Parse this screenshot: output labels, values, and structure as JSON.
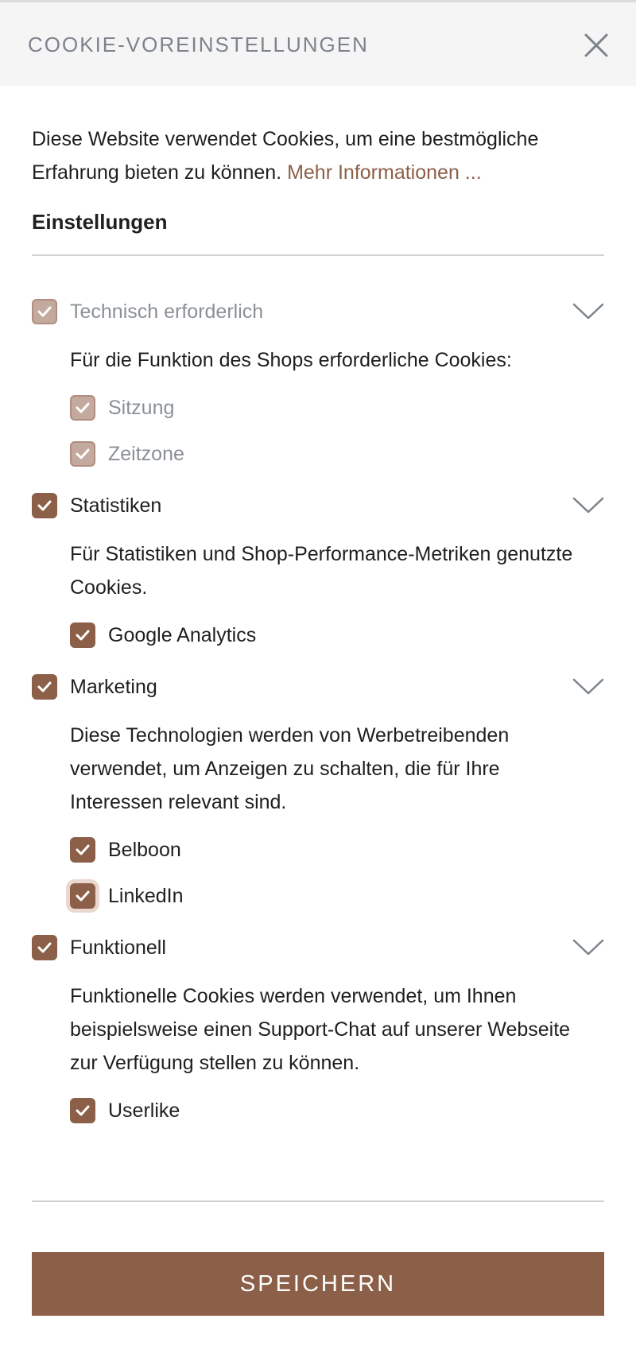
{
  "modal": {
    "title": "COOKIE-VOREINSTELLUNGEN",
    "close_icon": "close-icon"
  },
  "intro": {
    "text": "Diese Website verwendet Cookies, um eine bestmögliche Erfahrung bieten zu können.",
    "link_text": "Mehr Informationen ..."
  },
  "settings_heading": "Einstellungen",
  "categories": [
    {
      "label": "Technisch erforderlich",
      "checked": true,
      "disabled": true,
      "description": "Für die Funktion des Shops erforderliche Cookies:",
      "items": [
        {
          "label": "Sitzung",
          "checked": true,
          "disabled": true
        },
        {
          "label": "Zeitzone",
          "checked": true,
          "disabled": true
        }
      ]
    },
    {
      "label": "Statistiken",
      "checked": true,
      "disabled": false,
      "description": "Für Statistiken und Shop-Performance-Metriken genutzte Cookies.",
      "items": [
        {
          "label": "Google Analytics",
          "checked": true,
          "disabled": false
        }
      ]
    },
    {
      "label": "Marketing",
      "checked": true,
      "disabled": false,
      "description": "Diese Technologien werden von Werbetreibenden verwendet, um Anzeigen zu schalten, die für Ihre Interessen relevant sind.",
      "items": [
        {
          "label": "Belboon",
          "checked": true,
          "disabled": false
        },
        {
          "label": "LinkedIn",
          "checked": true,
          "disabled": false,
          "focused": true
        }
      ]
    },
    {
      "label": "Funktionell",
      "checked": true,
      "disabled": false,
      "description": "Funktionelle Cookies werden verwendet, um Ihnen beispielsweise einen Support-Chat auf unserer Webseite zur Verfügung stellen zu können.",
      "items": [
        {
          "label": "Userlike",
          "checked": true,
          "disabled": false
        }
      ]
    }
  ],
  "save_button": "SPEICHERN",
  "colors": {
    "accent": "#8c5f48",
    "disabled_checkbox": "#c4aa9e",
    "muted_text": "#8a9096",
    "header_bg": "#f5f5f5"
  }
}
